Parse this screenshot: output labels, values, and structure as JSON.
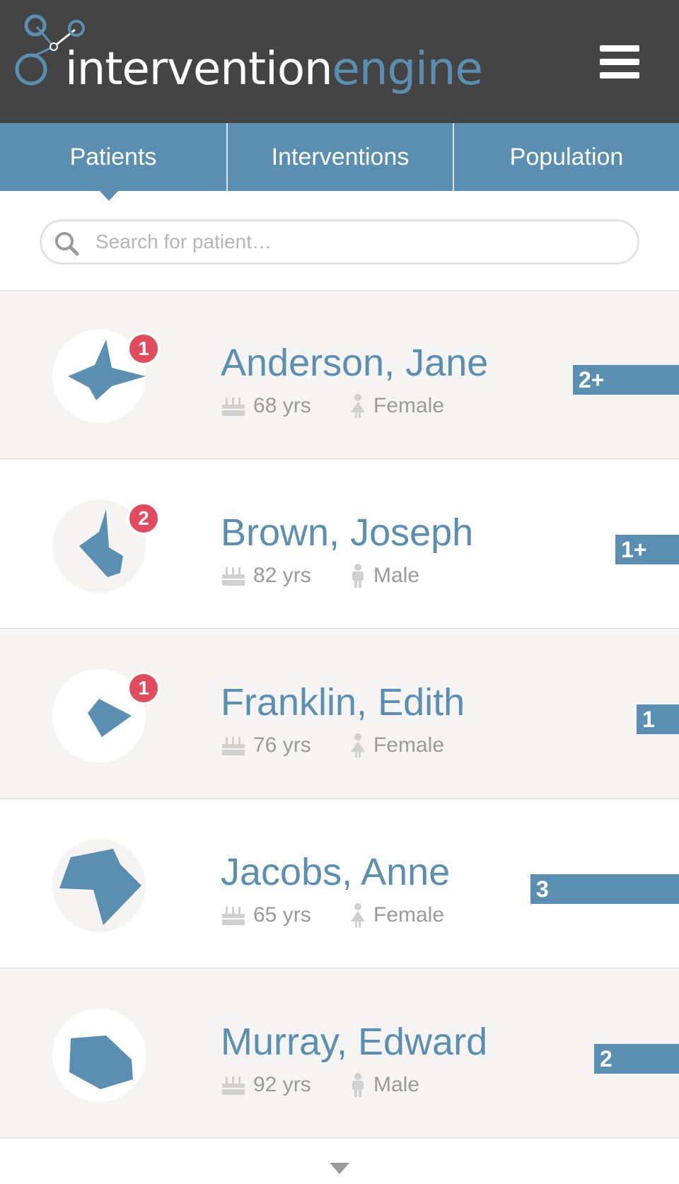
{
  "header": {
    "logo_part1": "intervention",
    "logo_part2": "engine",
    "menu_icon": "hamburger-menu-icon"
  },
  "colors": {
    "header_bg": "#444444",
    "accent": "#5b8fb2",
    "badge": "#e04c5e",
    "row_shade": "#f5f4f3"
  },
  "tabs": [
    {
      "label": "Patients",
      "active": true
    },
    {
      "label": "Interventions",
      "active": false
    },
    {
      "label": "Population",
      "active": false
    }
  ],
  "search": {
    "placeholder": "Search for patient…",
    "value": "",
    "icon": "search-icon"
  },
  "patients": [
    {
      "name": "Anderson, Jane",
      "age": "68 yrs",
      "gender": "Female",
      "badge": "1",
      "risk": "2+"
    },
    {
      "name": "Brown, Joseph",
      "age": "82 yrs",
      "gender": "Male",
      "badge": "2",
      "risk": "1+"
    },
    {
      "name": "Franklin, Edith",
      "age": "76 yrs",
      "gender": "Female",
      "badge": "1",
      "risk": "1"
    },
    {
      "name": "Jacobs, Anne",
      "age": "65 yrs",
      "gender": "Female",
      "badge": null,
      "risk": "3"
    },
    {
      "name": "Murray, Edward",
      "age": "92 yrs",
      "gender": "Male",
      "badge": null,
      "risk": "2"
    }
  ]
}
